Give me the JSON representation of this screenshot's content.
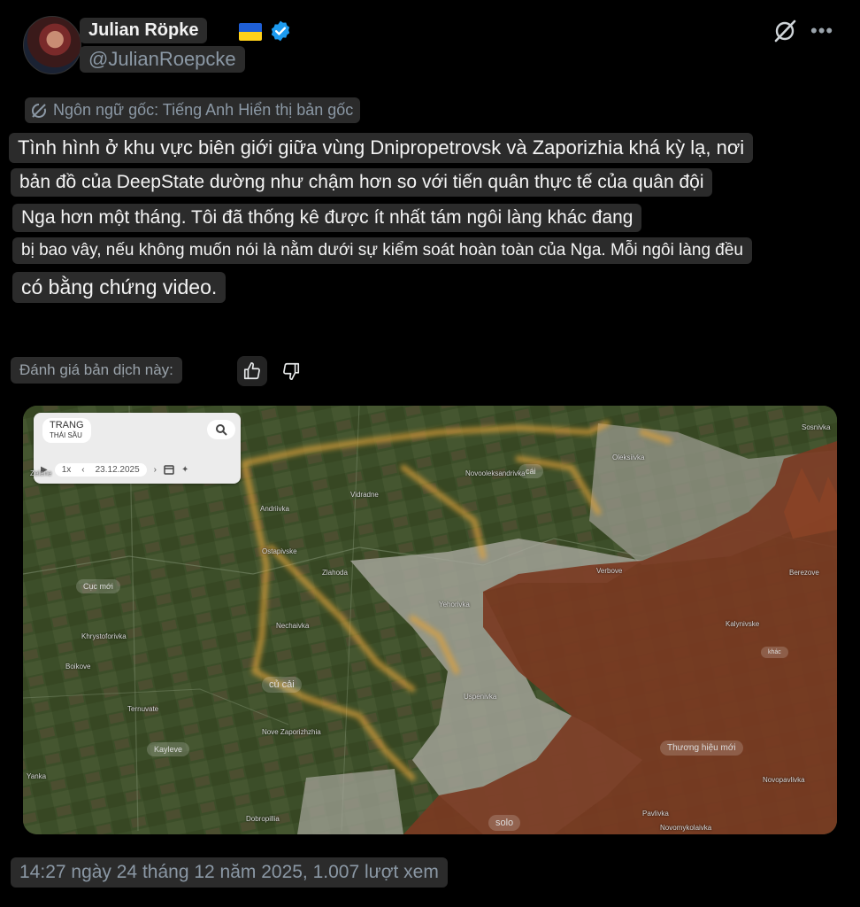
{
  "author": {
    "name": "Julian Röpke",
    "handle": "@JulianRoepcke"
  },
  "icons": {
    "flag": "ukraine-flag-icon",
    "verified": "verified-badge-icon",
    "grok": "grok-icon",
    "more": "more-options-icon",
    "translate": "translate-icon",
    "thumbs_up": "thumbs-up-icon",
    "thumbs_down": "thumbs-down-icon",
    "search": "search-icon",
    "calendar": "calendar-icon"
  },
  "translation": {
    "original_language": "Ngôn ngữ gốc: Tiếng Anh Hiển thị bản gốc",
    "lines": [
      "Tình hình ở khu vực biên giới giữa vùng Dnipropetrovsk và Zaporizhia khá kỳ lạ, nơi",
      "bản đồ của DeepState dường như chậm hơn so với tiến quân thực tế của quân đội",
      "Nga hơn một tháng. Tôi đã thống kê được ít nhất tám ngôi làng khác đang",
      "bị bao vây, nếu không muốn nói là nằm dưới sự kiểm soát hoàn toàn của Nga. Mỗi ngôi làng đều",
      "có bằng chứng video."
    ],
    "rate_label": "Đánh giá bản dịch này:"
  },
  "map": {
    "panel_title": "TRANG",
    "panel_subtitle": "THÁI SẦU",
    "speed": "1x",
    "date": "23.12.2025",
    "labels": {
      "cai": "cái",
      "cuc_moi": "Cục mới",
      "cu_cai": "củ cải",
      "kayleve": "Kayleve",
      "thuong_hieu_moi": "Thương hiệu mới",
      "solo": "solo",
      "khac": "khác"
    },
    "towns": {
      "zelene": "Zelene",
      "andriivka": "Andriivka",
      "vidradne": "Vidradne",
      "ostapivske": "Ostapivske",
      "novooleksandrivka": "Novooleksandrivka",
      "oleksiivka": "Oleksiivka",
      "sosnivka": "Sosnivka",
      "nechaivka": "Nechaivka",
      "khrystoforivka": "Khrystoforivka",
      "boikove": "Boikove",
      "ternuvate": "Ternuvate",
      "nove_zaporizhzhia": "Nove Zaporizhzhia",
      "dobropillia": "Dobropillia",
      "yehorivka": "Yehorivka",
      "verbove": "Verbove",
      "kalynivske": "Kalynivske",
      "novopavlivka": "Novopavlivka",
      "pavlivka": "Pavlivka",
      "berezove": "Berezove",
      "zlahoda": "Zlahoda",
      "yanka": "Yanka",
      "novomykolaivka": "Novomykolaivka",
      "uspenivka": "Uspenivka"
    }
  },
  "footer": {
    "meta": "14:27 ngày 24 tháng 12 năm 2025, 1.007 lượt xem"
  }
}
